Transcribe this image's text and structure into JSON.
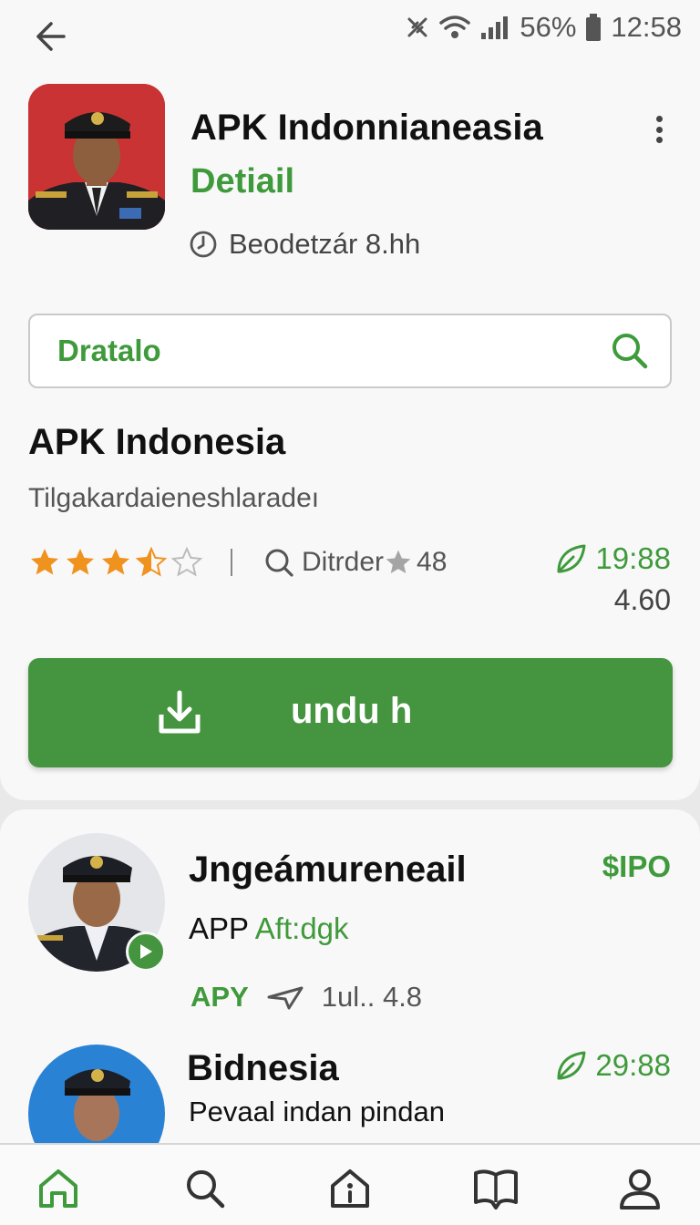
{
  "status_bar": {
    "battery": "56%",
    "time": "12:58"
  },
  "app": {
    "title": "APK Indonnianeasia",
    "subtitle": "Detiail",
    "meta": "Beodetzár 8.hh"
  },
  "search": {
    "value": "Dratalo"
  },
  "section": {
    "title": "APK Indonesia",
    "description": "Tilgakardaieneshlaradeı",
    "rating_stars": 3.5,
    "rating_label": "Ditrder",
    "rating_value": "48",
    "stat_top": "19:88",
    "stat_bottom": "4.60"
  },
  "download_button": {
    "label": "undu h"
  },
  "list": [
    {
      "title": "Jngeámureneail",
      "sub_prefix": "APP",
      "sub_green": "Aft:dgk",
      "price": "$IPO",
      "meta_tag": "APY",
      "meta_text": "1ul.. 4.8"
    },
    {
      "title": "Bidnesia",
      "sub_text": "Pevaal indan pindan",
      "stat": "29:88"
    }
  ],
  "colors": {
    "accent": "#45943f",
    "accent_text": "#3f9a3c",
    "star": "#f0921e"
  }
}
